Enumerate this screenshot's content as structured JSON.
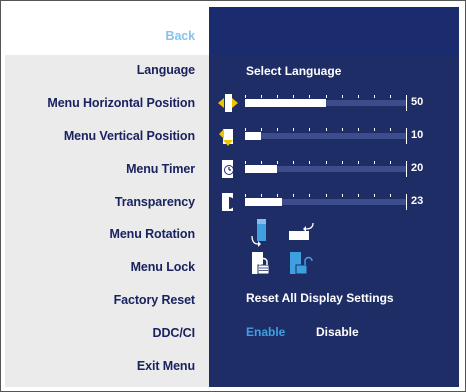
{
  "menu": {
    "items": [
      {
        "label": "Back"
      },
      {
        "label": "Language"
      },
      {
        "label": "Menu Horizontal Position"
      },
      {
        "label": "Menu Vertical Position"
      },
      {
        "label": "Menu Timer"
      },
      {
        "label": "Transparency"
      },
      {
        "label": "Menu Rotation"
      },
      {
        "label": "Menu Lock"
      },
      {
        "label": "Factory Reset"
      },
      {
        "label": "DDC/CI"
      },
      {
        "label": "Exit Menu"
      }
    ]
  },
  "settings": {
    "language_label": "Select Language",
    "horizontal_position": {
      "value": "50",
      "fraction": 0.5,
      "icon": "horizontal-arrows-icon"
    },
    "vertical_position": {
      "value": "10",
      "fraction": 0.1,
      "icon": "vertical-arrows-icon"
    },
    "menu_timer": {
      "value": "20",
      "fraction": 0.2,
      "icon": "timer-icon"
    },
    "transparency": {
      "value": "23",
      "fraction": 0.23,
      "icon": "transparency-icon"
    },
    "rotation_icons": [
      "rotate-portrait-icon",
      "rotate-landscape-icon"
    ],
    "lock_icons": [
      "locked-icon",
      "unlocked-icon"
    ],
    "reset_label": "Reset All Display Settings",
    "ddc_ci": {
      "enable": "Enable",
      "disable": "Disable",
      "selected": "Enable"
    }
  },
  "colors": {
    "panel": "#1f2d66",
    "accent": "#3fa0e0",
    "back_text": "#86c3ea",
    "menu_text": "#1a2360"
  }
}
